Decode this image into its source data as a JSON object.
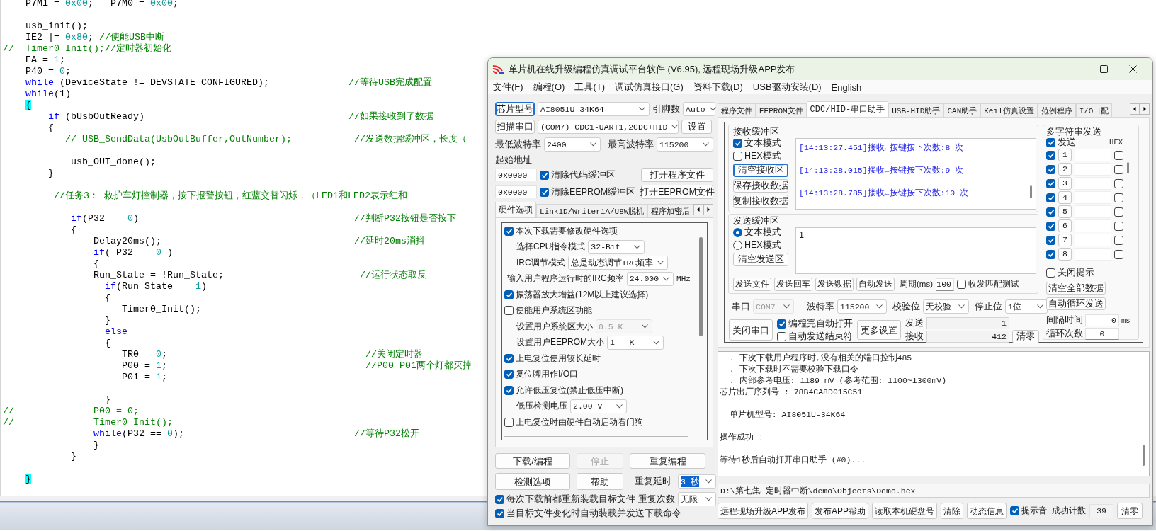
{
  "editor": {
    "lines": [
      {
        "kind": "code",
        "segments": [
          {
            "kind": "plain",
            "text": "    P7M1 = "
          },
          {
            "kind": "number",
            "text": "0x00"
          },
          {
            "kind": "plain",
            "text": ";   P7M0 = "
          },
          {
            "kind": "number",
            "text": "0x00"
          },
          {
            "kind": "plain",
            "text": ";"
          }
        ]
      },
      {
        "kind": "blank"
      },
      {
        "kind": "code",
        "segments": [
          {
            "kind": "plain",
            "text": "    usb_init();"
          }
        ]
      },
      {
        "kind": "code",
        "segments": [
          {
            "kind": "plain",
            "text": "    IE2 |= "
          },
          {
            "kind": "number",
            "text": "0x80"
          },
          {
            "kind": "plain",
            "text": "; "
          },
          {
            "kind": "comment",
            "text": "//使能USB中断"
          }
        ]
      },
      {
        "kind": "code",
        "segments": [
          {
            "kind": "comment",
            "text": "//  Timer0_Init();//定时器初始化"
          }
        ]
      },
      {
        "kind": "code",
        "segments": [
          {
            "kind": "plain",
            "text": "    EA = "
          },
          {
            "kind": "number",
            "text": "1"
          },
          {
            "kind": "plain",
            "text": ";"
          }
        ]
      },
      {
        "kind": "code",
        "segments": [
          {
            "kind": "plain",
            "text": "    P40 = "
          },
          {
            "kind": "number",
            "text": "0"
          },
          {
            "kind": "plain",
            "text": ";"
          }
        ]
      },
      {
        "kind": "code",
        "segments": [
          {
            "kind": "keyword",
            "text": "    while"
          },
          {
            "kind": "plain",
            "text": " (DeviceState != DEVSTATE_CONFIGURED);              "
          },
          {
            "kind": "comment",
            "text": "//等待USB完成配置"
          }
        ]
      },
      {
        "kind": "code",
        "segments": [
          {
            "kind": "keyword",
            "text": "    while"
          },
          {
            "kind": "plain",
            "text": "(1)"
          }
        ]
      },
      {
        "kind": "code",
        "segments": [
          {
            "kind": "brace_match",
            "text": "    {"
          }
        ]
      },
      {
        "kind": "code",
        "segments": [
          {
            "kind": "keyword",
            "text": "        if"
          },
          {
            "kind": "plain",
            "text": " (bUsbOutReady)                                    "
          },
          {
            "kind": "comment",
            "text": "//如果接收到了数据"
          }
        ]
      },
      {
        "kind": "code",
        "segments": [
          {
            "kind": "plain",
            "text": "        {"
          }
        ]
      },
      {
        "kind": "code",
        "segments": [
          {
            "kind": "comment",
            "text": "           // USB_SendData(UsbOutBuffer,OutNumber);           //发送数据缓冲区，长度（"
          }
        ]
      },
      {
        "kind": "blank"
      },
      {
        "kind": "code",
        "segments": [
          {
            "kind": "plain",
            "text": "            usb_OUT_done();"
          }
        ]
      },
      {
        "kind": "code",
        "segments": [
          {
            "kind": "plain",
            "text": "        }"
          }
        ]
      },
      {
        "kind": "blank"
      },
      {
        "kind": "code",
        "segments": [
          {
            "kind": "comment",
            "text": "         //任务3： 救护车灯控制器，按下报警按钮，红蓝交替闪烁，（LED1和LED2表示红和"
          }
        ]
      },
      {
        "kind": "blank"
      },
      {
        "kind": "code",
        "segments": [
          {
            "kind": "keyword",
            "text": "            if"
          },
          {
            "kind": "plain",
            "text": "(P32 == "
          },
          {
            "kind": "number",
            "text": "0"
          },
          {
            "kind": "plain",
            "text": ")                                      "
          },
          {
            "kind": "comment",
            "text": "//判断P32按钮是否按下"
          }
        ]
      },
      {
        "kind": "code",
        "segments": [
          {
            "kind": "plain",
            "text": "            {"
          }
        ]
      },
      {
        "kind": "code",
        "segments": [
          {
            "kind": "plain",
            "text": "                Delay20ms();                                  "
          },
          {
            "kind": "comment",
            "text": "//延时20ms消抖"
          }
        ]
      },
      {
        "kind": "code",
        "segments": [
          {
            "kind": "keyword",
            "text": "                if"
          },
          {
            "kind": "plain",
            "text": "( P32 == "
          },
          {
            "kind": "number",
            "text": "0"
          },
          {
            "kind": "plain",
            "text": " )"
          }
        ]
      },
      {
        "kind": "code",
        "segments": [
          {
            "kind": "plain",
            "text": "                {"
          }
        ]
      },
      {
        "kind": "code",
        "segments": [
          {
            "kind": "plain",
            "text": "                Run_State = !Run_State;                        "
          },
          {
            "kind": "comment",
            "text": "//运行状态取反"
          }
        ]
      },
      {
        "kind": "code",
        "segments": [
          {
            "kind": "keyword",
            "text": "                  if"
          },
          {
            "kind": "plain",
            "text": "(Run_State == "
          },
          {
            "kind": "number",
            "text": "1"
          },
          {
            "kind": "plain",
            "text": ")"
          }
        ]
      },
      {
        "kind": "code",
        "segments": [
          {
            "kind": "plain",
            "text": "                  {"
          }
        ]
      },
      {
        "kind": "code",
        "segments": [
          {
            "kind": "plain",
            "text": "                     Timer0_Init();"
          }
        ]
      },
      {
        "kind": "code",
        "segments": [
          {
            "kind": "plain",
            "text": "                  }"
          }
        ]
      },
      {
        "kind": "code",
        "segments": [
          {
            "kind": "keyword",
            "text": "                  else"
          }
        ]
      },
      {
        "kind": "code",
        "segments": [
          {
            "kind": "plain",
            "text": "                  {"
          }
        ]
      },
      {
        "kind": "code",
        "segments": [
          {
            "kind": "plain",
            "text": "                     TR0 = "
          },
          {
            "kind": "number",
            "text": "0"
          },
          {
            "kind": "plain",
            "text": ";                                   "
          },
          {
            "kind": "comment",
            "text": "//关闭定时器"
          }
        ]
      },
      {
        "kind": "code",
        "segments": [
          {
            "kind": "plain",
            "text": "                     P00 = "
          },
          {
            "kind": "number",
            "text": "1"
          },
          {
            "kind": "plain",
            "text": ";                                   "
          },
          {
            "kind": "comment",
            "text": "//P00 P01两个灯都灭掉"
          }
        ]
      },
      {
        "kind": "code",
        "segments": [
          {
            "kind": "plain",
            "text": "                     P01 = "
          },
          {
            "kind": "number",
            "text": "1"
          },
          {
            "kind": "plain",
            "text": ";"
          }
        ]
      },
      {
        "kind": "blank"
      },
      {
        "kind": "code",
        "segments": [
          {
            "kind": "plain",
            "text": "                  }"
          }
        ]
      },
      {
        "kind": "code",
        "segments": [
          {
            "kind": "comment",
            "text": "//              P00 = 0;"
          }
        ]
      },
      {
        "kind": "code",
        "segments": [
          {
            "kind": "comment",
            "text": "//              Timer0_Init();"
          }
        ]
      },
      {
        "kind": "code",
        "segments": [
          {
            "kind": "keyword",
            "text": "                while"
          },
          {
            "kind": "plain",
            "text": "(P32 == "
          },
          {
            "kind": "number",
            "text": "0"
          },
          {
            "kind": "plain",
            "text": ");                              "
          },
          {
            "kind": "comment",
            "text": "//等待P32松开"
          }
        ]
      },
      {
        "kind": "code",
        "segments": [
          {
            "kind": "plain",
            "text": "                }"
          }
        ]
      },
      {
        "kind": "code",
        "segments": [
          {
            "kind": "plain",
            "text": "            }"
          }
        ]
      },
      {
        "kind": "blank"
      },
      {
        "kind": "code",
        "segments": [
          {
            "kind": "brace_match",
            "text": "    }"
          }
        ]
      }
    ]
  },
  "window": {
    "title": "单片机在线升级编程仿真调试平台软件 (V6.95), 远程现场升级APP发布",
    "menu": [
      "文件(F)",
      "编程(O)",
      "工具(T)",
      "调试仿真接口(G)",
      "资料下载(D)",
      "USB驱动安装(D)",
      "English"
    ],
    "chip": {
      "button": "芯片型号",
      "button_focused": true,
      "value": "AI8051U-34K64",
      "pins_label": "引脚数",
      "pins_value": "Auto"
    },
    "port": {
      "button": "扫描串口",
      "value": "(COM7) CDC1-UART1,2CDC+HID",
      "settings_button": "设置"
    },
    "baud": {
      "min_label": "最低波特率",
      "min_value": "2400",
      "max_label": "最高波特率",
      "max_value": "115200"
    },
    "start_address_label": "起始地址",
    "buffers": [
      {
        "address": "0x0000",
        "label": "清除代码缓冲区",
        "checked": true,
        "button": "打开程序文件"
      },
      {
        "address": "0x0000",
        "label": "清除EEPROM缓冲区",
        "checked": true,
        "button": "打开EEPROM文件"
      }
    ],
    "left_tabs": [
      {
        "label": "硬件选项",
        "selected": true
      },
      {
        "label": "Link1D/Writer1A/U8W脱机",
        "selected": false
      },
      {
        "label": "程序加密后",
        "selected": false
      }
    ],
    "hardware_options": [
      {
        "kind": "checkbox",
        "label": "本次下载需要修改硬件选项",
        "checked": true
      },
      {
        "kind": "select",
        "label": "选择CPU指令模式",
        "value": "32-Bit",
        "disabled": false
      },
      {
        "kind": "select",
        "label": "IRC调节模式",
        "value": "总是动态调节IRC频率",
        "disabled": false
      },
      {
        "kind": "select",
        "label": "输入用户程序运行时的IRC频率",
        "value": "24.000",
        "unit": "MHz",
        "disabled": false
      },
      {
        "kind": "checkbox",
        "label": "振荡器放大增益(12M以上建议选择)",
        "checked": true
      },
      {
        "kind": "checkbox",
        "label": "使能用户系统区功能",
        "checked": false
      },
      {
        "kind": "select",
        "label": "设置用户系统区大小",
        "value": "0.5 K",
        "disabled": true
      },
      {
        "kind": "select",
        "label": "设置用户EEPROM大小",
        "value": "1   K",
        "disabled": false
      },
      {
        "kind": "checkbox",
        "label": "上电复位使用较长延时",
        "checked": true
      },
      {
        "kind": "checkbox",
        "label": "复位脚用作I/O口",
        "checked": true
      },
      {
        "kind": "checkbox",
        "label": "允许低压复位(禁止低压中断)",
        "checked": true
      },
      {
        "kind": "select",
        "label": "低压检测电压",
        "value": "2.00 V",
        "disabled": false
      },
      {
        "kind": "checkbox",
        "label": "上电复位时由硬件自动启动看门狗",
        "checked": false
      }
    ],
    "action_buttons": [
      {
        "label": "下载/编程",
        "disabled": false
      },
      {
        "label": "停止",
        "disabled": true
      },
      {
        "label": "重复编程",
        "disabled": false
      },
      {
        "label": "检测选项",
        "disabled": false
      },
      {
        "label": "帮助",
        "disabled": false
      }
    ],
    "repeat_delay": {
      "label": "重复延时",
      "value": "3 秒",
      "text_selected": true
    },
    "repeat_count": {
      "label": "重复次数",
      "value": "无限"
    },
    "reload_options": [
      {
        "label": "每次下载前都重新装载目标文件",
        "checked": true
      },
      {
        "label": "当目标文件变化时自动装载并发送下载命令",
        "checked": true
      }
    ],
    "right_tabs": [
      {
        "label": "程序文件",
        "selected": false
      },
      {
        "label": "EEPROM文件",
        "selected": false
      },
      {
        "label": "CDC/HID-串口助手",
        "selected": true
      },
      {
        "label": "USB-HID助手",
        "selected": false
      },
      {
        "label": "CAN助手",
        "selected": false
      },
      {
        "label": "Keil仿真设置",
        "selected": false
      },
      {
        "label": "范例程序",
        "selected": false
      },
      {
        "label": "I/O口配",
        "selected": false
      }
    ],
    "receive": {
      "title": "接收缓冲区",
      "modes": [
        {
          "label": "文本模式",
          "checked": true
        },
        {
          "label": "HEX模式",
          "checked": false
        }
      ],
      "buttons": [
        {
          "label": "清空接收区",
          "focused": true
        },
        {
          "label": "保存接收数据",
          "focused": false
        },
        {
          "label": "复制接收数据",
          "focused": false
        }
      ],
      "lines": [
        "[14:13:27.451]接收←按键按下次数:8 次",
        "[14:13:28.015]接收←按键按下次数:9 次",
        "[14:13:28.785]接收←按键按下次数:10 次"
      ]
    },
    "send": {
      "title": "发送缓冲区",
      "modes": [
        {
          "label": "文本模式",
          "selected": true
        },
        {
          "label": "HEX模式",
          "selected": false
        }
      ],
      "clear_button": "清空发送区",
      "value": "1",
      "buttons": [
        "发送文件",
        "发送回车",
        "发送数据",
        "自动发送"
      ],
      "period_label": "周期(ms)",
      "period_value": "100",
      "match_test": {
        "label": "收发匹配测试",
        "checked": false
      }
    },
    "serial": {
      "port_label": "串口",
      "port_value": "COM7",
      "port_disabled": true,
      "baud_label": "波特率",
      "baud_value": "115200",
      "parity_label": "校验位",
      "parity_value": "无校验",
      "stop_label": "停止位",
      "stop_value": "1位"
    },
    "serial_actions": {
      "close_button": "关闭串口",
      "options": [
        {
          "label": "编程完自动打开",
          "checked": true
        },
        {
          "label": "自动发送结束符",
          "checked": false
        }
      ],
      "more_button": "更多设置",
      "counters": [
        {
          "label": "发送",
          "value": "1"
        },
        {
          "label": "接收",
          "value": "412"
        }
      ],
      "reset_button": "清零"
    },
    "multi_send": {
      "title": "多字符串发送",
      "send": {
        "label": "发送",
        "checked": true
      },
      "hex_label": "HEX",
      "rows": [
        {
          "number": "1",
          "checked": true,
          "hex": false
        },
        {
          "number": "2",
          "checked": true,
          "hex": false
        },
        {
          "number": "3",
          "checked": true,
          "hex": false
        },
        {
          "number": "4",
          "checked": true,
          "hex": false
        },
        {
          "number": "5",
          "checked": true,
          "hex": false
        },
        {
          "number": "6",
          "checked": true,
          "hex": false
        },
        {
          "number": "7",
          "checked": true,
          "hex": false
        },
        {
          "number": "8",
          "checked": true,
          "hex": false
        }
      ],
      "hide_tips": {
        "label": "关闭提示",
        "checked": false
      },
      "buttons": [
        "清空全部数据",
        "自动循环发送"
      ],
      "interval_label": "间隔时间",
      "interval_value": "0",
      "interval_unit": "ms",
      "loop_label": "循环次数",
      "loop_value": "0"
    },
    "log": [
      {
        "kind": "text",
        "text": "  . 下次下载用户程序时,没有相关的端口控制485"
      },
      {
        "kind": "text",
        "text": "  . 下次下载时不需要校验下载口令"
      },
      {
        "kind": "text",
        "text": "  . 内部参考电压: 1189 mV (参考范围: 1100~1300mV)"
      },
      {
        "kind": "text",
        "text": "芯片出厂序列号 : 78B4CA8D015C51"
      },
      {
        "kind": "blank"
      },
      {
        "kind": "text",
        "text": "  单片机型号: AI8051U-34K64"
      },
      {
        "kind": "blank"
      },
      {
        "kind": "text",
        "text": "操作成功 !"
      },
      {
        "kind": "blank"
      },
      {
        "kind": "text",
        "text": "等待1秒后自动打开串口助手 (#0)..."
      }
    ],
    "file_path": "D:\\第七集 定时器中断\\demo\\Objects\\Demo.hex",
    "bottom_buttons": [
      "远程现场升级APP发布",
      "发布APP帮助",
      "读取本机硬盘号",
      "清除",
      "动态信息"
    ],
    "beep": {
      "label": "提示音",
      "checked": true
    },
    "success_count": {
      "label": "成功计数",
      "value": "39",
      "reset_button": "清零"
    }
  }
}
